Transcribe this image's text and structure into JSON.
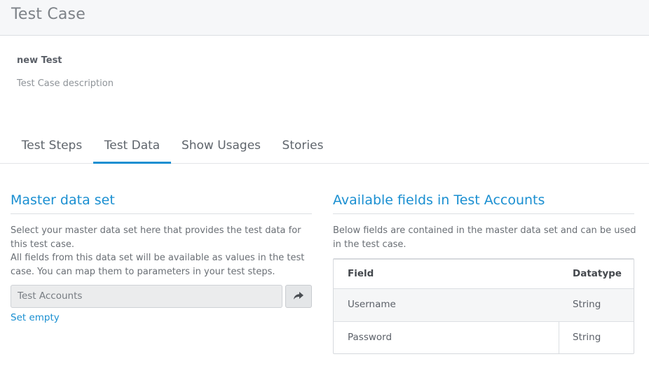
{
  "header": {
    "title": "Test Case"
  },
  "test_case": {
    "name": "new Test",
    "description": "Test Case description"
  },
  "tabs": [
    {
      "label": "Test Steps",
      "active": false
    },
    {
      "label": "Test Data",
      "active": true
    },
    {
      "label": "Show Usages",
      "active": false
    },
    {
      "label": "Stories",
      "active": false
    }
  ],
  "master_data_set": {
    "title": "Master data set",
    "help_line1": "Select your master data set here that provides the test data for",
    "help_line2": "this test case.",
    "help_line3": "All fields from this data set will be available as values in the test",
    "help_line4": "case. You can map them to parameters in your test steps.",
    "selected_value": "Test Accounts",
    "go_button_icon": "share-arrow-icon",
    "set_empty_label": "Set empty"
  },
  "available_fields": {
    "title": "Available fields in Test Accounts",
    "help_line1": "Below fields are contained in the master data set and can be used",
    "help_line2": "in the test case.",
    "columns": [
      "Field",
      "Datatype"
    ],
    "rows": [
      {
        "field": "Username",
        "datatype": "String"
      },
      {
        "field": "Password",
        "datatype": "String"
      }
    ]
  },
  "colors": {
    "accent": "#1a8fd1",
    "header_bg": "#f6f7f9",
    "text": "#555a60"
  }
}
